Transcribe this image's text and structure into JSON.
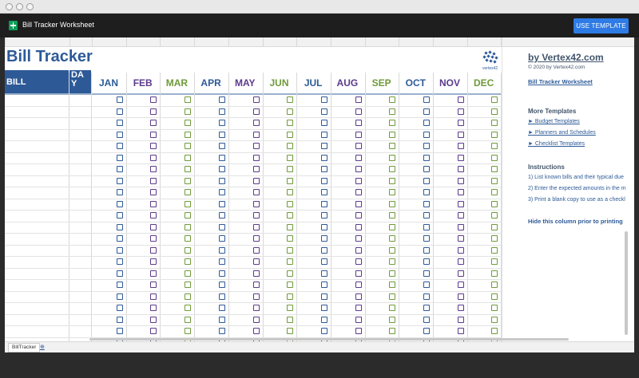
{
  "app": {
    "title": "Bill Tracker Worksheet",
    "use_template_label": "USE TEMPLATE"
  },
  "sheet": {
    "title": "Bill Tracker",
    "bill_header": "BILL",
    "day_header": "DA\nY",
    "months": [
      "JAN",
      "FEB",
      "MAR",
      "APR",
      "MAY",
      "JUN",
      "JUL",
      "AUG",
      "SEP",
      "OCT",
      "NOV",
      "DEC"
    ],
    "month_colors": [
      "#2d5a97",
      "#5b3a8c",
      "#6f9a3a",
      "#2d5a97",
      "#5b3a8c",
      "#6f9a3a",
      "#2d5a97",
      "#5b3a8c",
      "#6f9a3a",
      "#2d5a97",
      "#5b3a8c",
      "#6f9a3a"
    ],
    "logo_text": "vertex42",
    "row_count": 22
  },
  "sidebar": {
    "brand": "by Vertex42.com",
    "copyright": "© 2020 by Vertex42.com",
    "worksheet_link": "Bill Tracker Worksheet",
    "more_templates_title": "More Templates",
    "more_templates": [
      "► Budget Templates",
      "► Planners and Schedules",
      "► Checklist Templates"
    ],
    "instructions_title": "Instructions",
    "instructions": [
      "1) List known bills and their typical due",
      "2) Enter the expected amounts in the m",
      "3) Print a blank copy to use as a checkl"
    ],
    "hide_note": "Hide this column prior to printing"
  },
  "tabs": {
    "active": "BillTracker",
    "add": "⊕"
  }
}
